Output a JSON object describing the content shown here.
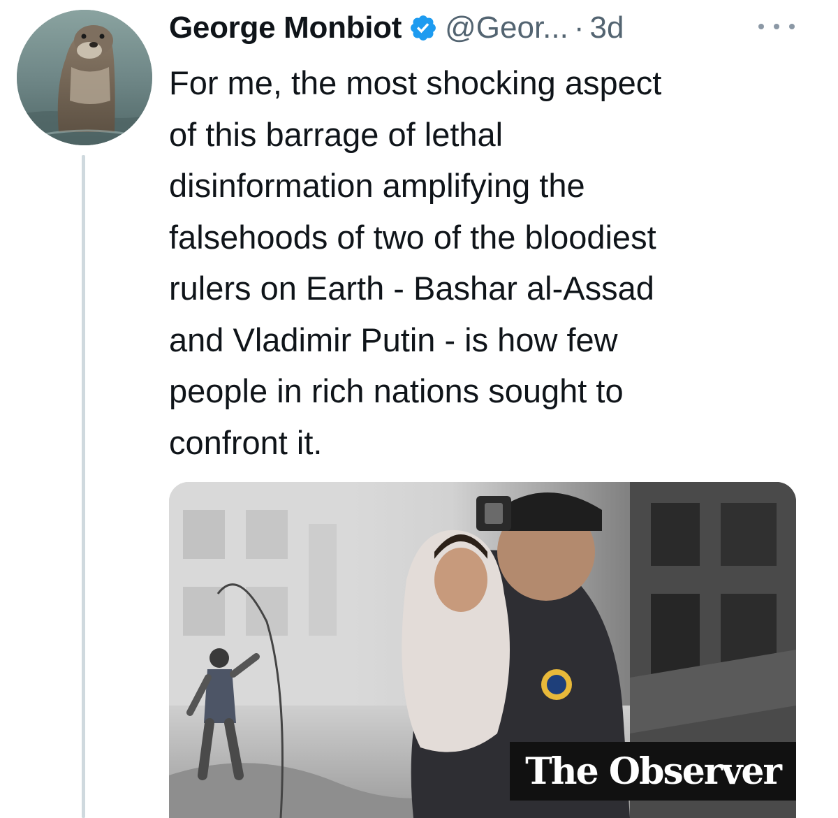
{
  "tweet": {
    "author_name": "George Monbiot",
    "handle": "@Geor...",
    "separator": "·",
    "time": "3d",
    "verified_icon": "verified-badge-icon",
    "more_icon": "more-options-icon",
    "text": "For me, the most shocking aspect\nof this barrage of lethal\ndisinformation amplifying the\nfalsehoods of two of the bloodiest\nrulers on Earth - Bashar al-Assad\nand Vladimir Putin - is how few\npeople in rich nations sought to\nconfront it."
  },
  "link_card": {
    "publisher_logo_text": "The Observer"
  },
  "colors": {
    "verified_blue": "#1d9bf0",
    "secondary_text": "#536471",
    "thread_line": "#cfd9de",
    "publisher_bg": "#111111"
  }
}
